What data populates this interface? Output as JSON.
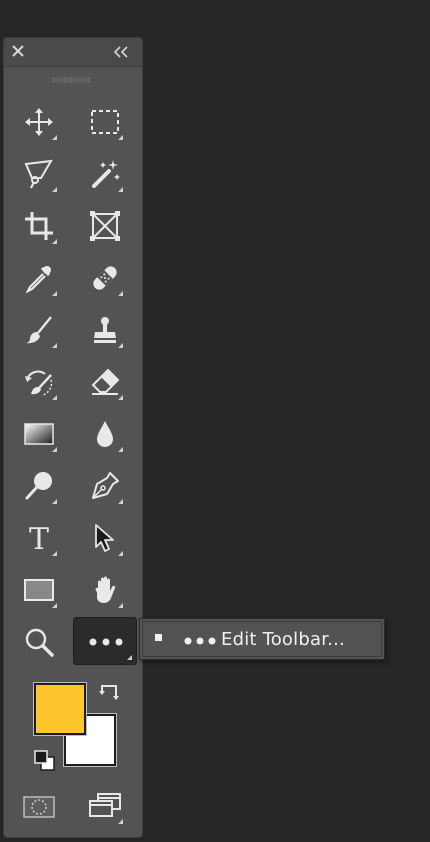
{
  "panel": {
    "close_icon": "close-icon",
    "collapse_icon": "double-chevron-left-icon"
  },
  "tools": [
    {
      "name": "move-tool",
      "icon": "move-icon"
    },
    {
      "name": "rectangular-marquee-tool",
      "icon": "marquee-icon"
    },
    {
      "name": "lasso-tool",
      "icon": "polygonal-lasso-icon"
    },
    {
      "name": "magic-wand-tool",
      "icon": "magic-wand-icon"
    },
    {
      "name": "crop-tool",
      "icon": "crop-icon"
    },
    {
      "name": "frame-tool",
      "icon": "frame-icon"
    },
    {
      "name": "eyedropper-tool",
      "icon": "eyedropper-icon"
    },
    {
      "name": "healing-brush-tool",
      "icon": "bandage-icon"
    },
    {
      "name": "brush-tool",
      "icon": "brush-icon"
    },
    {
      "name": "clone-stamp-tool",
      "icon": "stamp-icon"
    },
    {
      "name": "history-brush-tool",
      "icon": "history-brush-icon"
    },
    {
      "name": "eraser-tool",
      "icon": "eraser-icon"
    },
    {
      "name": "gradient-tool",
      "icon": "gradient-icon"
    },
    {
      "name": "blur-tool",
      "icon": "water-drop-icon"
    },
    {
      "name": "dodge-tool",
      "icon": "dodge-icon"
    },
    {
      "name": "pen-tool",
      "icon": "pen-icon"
    },
    {
      "name": "type-tool",
      "icon": "type-icon",
      "glyph": "T"
    },
    {
      "name": "path-selection-tool",
      "icon": "arrow-cursor-icon"
    },
    {
      "name": "rectangle-tool",
      "icon": "rectangle-icon"
    },
    {
      "name": "hand-tool",
      "icon": "hand-icon"
    },
    {
      "name": "zoom-tool",
      "icon": "magnifier-icon"
    },
    {
      "name": "edit-toolbar-tool",
      "icon": "more-dots-icon"
    }
  ],
  "colors": {
    "foreground": "#FFC52C",
    "background": "#FFFFFF",
    "swap_icon": "swap-arrows-icon",
    "default_icon": "default-colors-icon"
  },
  "bottom": {
    "quick_mask_icon": "quick-mask-icon",
    "screen_mode_icon": "screen-mode-icon"
  },
  "flyout": {
    "label": "Edit Toolbar..."
  }
}
